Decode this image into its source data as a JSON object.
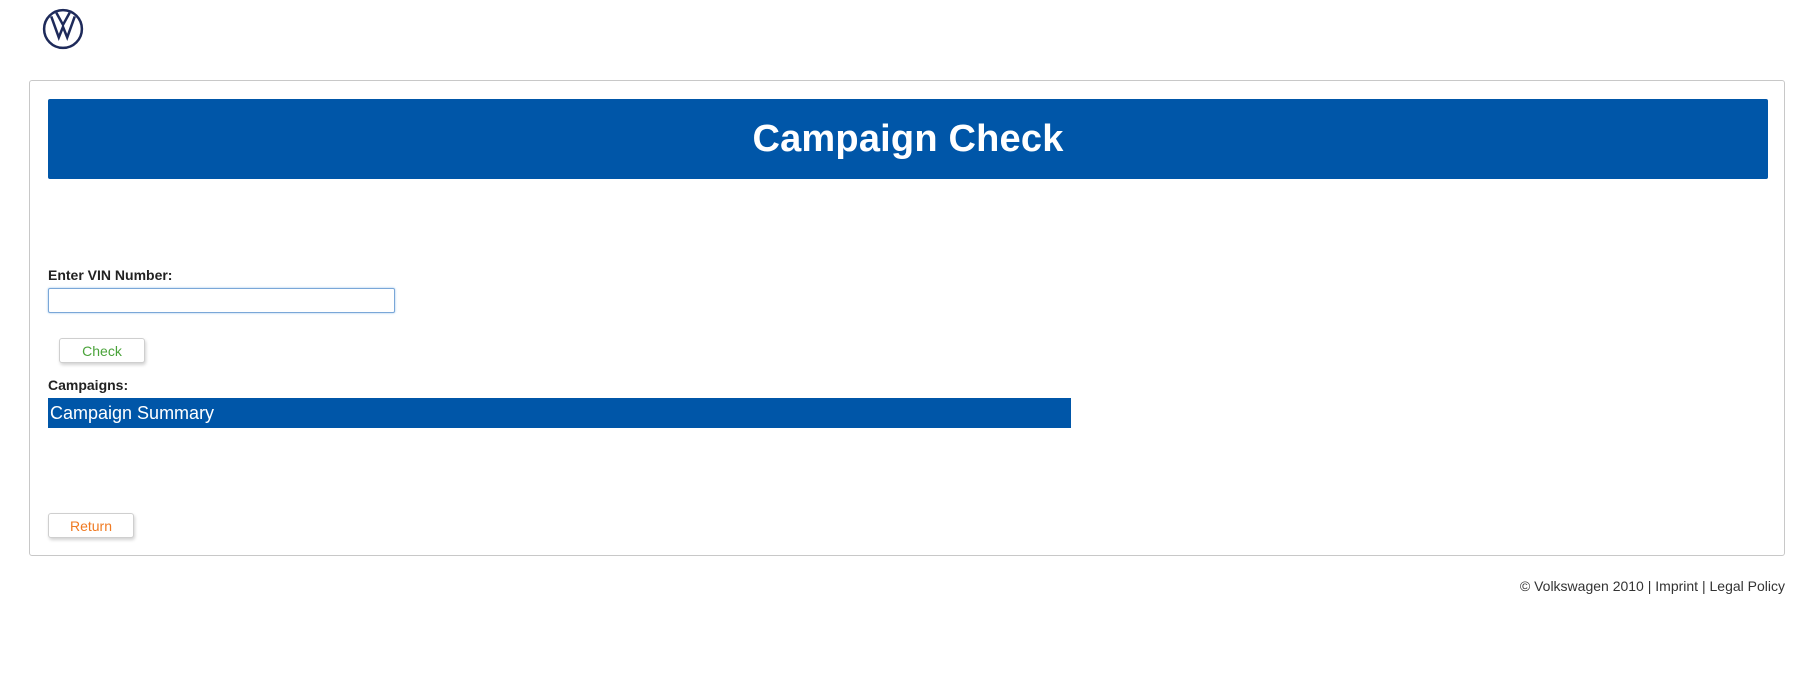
{
  "brand": {
    "logo_icon": "volkswagen-logo-icon",
    "logo_color": "#1e2a5a"
  },
  "header": {
    "title": "Campaign Check",
    "color": "#0056a8"
  },
  "form": {
    "vin_label": "Enter VIN Number:",
    "vin_value": "",
    "vin_placeholder": "",
    "check_label": "Check",
    "check_color": "#4aa33a"
  },
  "campaigns": {
    "label": "Campaigns:",
    "summary_label": "Campaign Summary"
  },
  "actions": {
    "return_label": "Return",
    "return_color": "#f07a22"
  },
  "footer": {
    "copyright": "© Volkswagen 2010",
    "separator1": " | ",
    "imprint": "Imprint",
    "separator2": " | ",
    "legal": "Legal Policy"
  }
}
